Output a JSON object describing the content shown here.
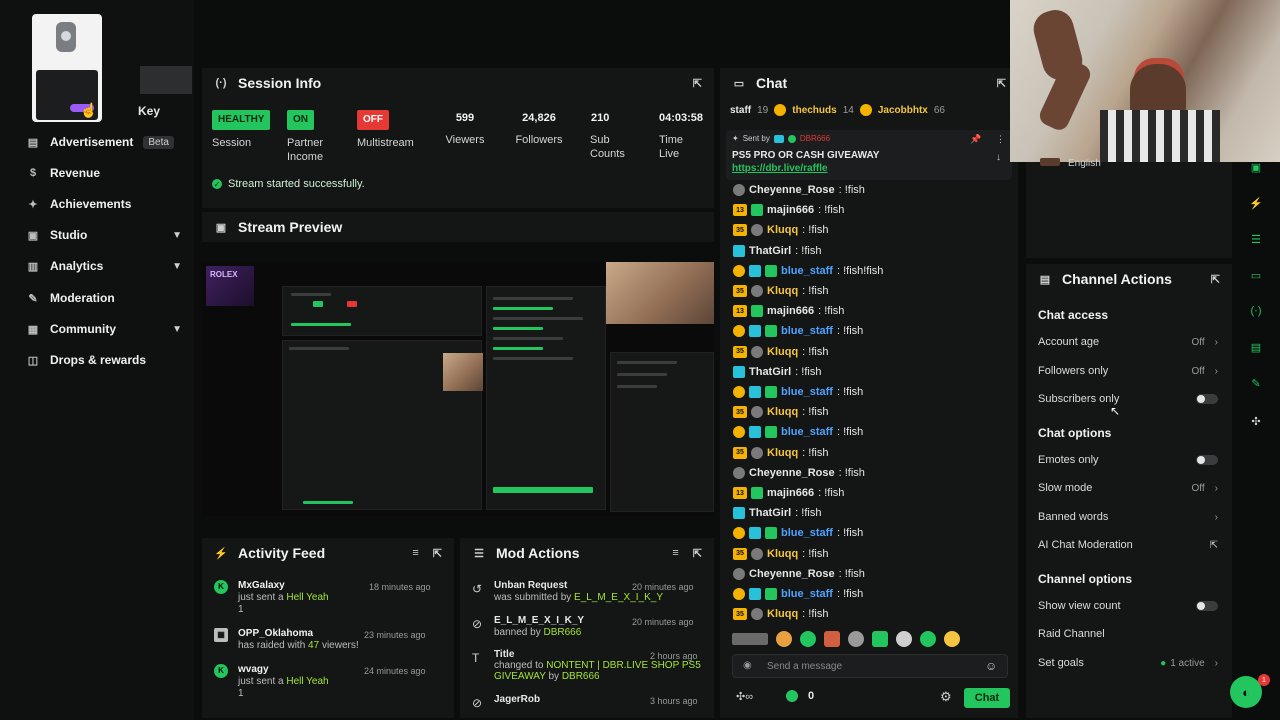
{
  "sidebar": {
    "key_label": "Key",
    "items": [
      {
        "label": "Advertisement",
        "badge": "Beta",
        "icon": "megaphone-icon"
      },
      {
        "label": "Revenue",
        "icon": "dollar-icon"
      },
      {
        "label": "Achievements",
        "icon": "trophy-icon"
      },
      {
        "label": "Studio",
        "icon": "camera-icon"
      },
      {
        "label": "Analytics",
        "icon": "chart-icon"
      },
      {
        "label": "Moderation",
        "icon": "wrench-icon"
      },
      {
        "label": "Community",
        "icon": "people-icon"
      },
      {
        "label": "Drops & rewards",
        "icon": "gift-icon"
      }
    ]
  },
  "session": {
    "title": "Session Info",
    "health": {
      "pill": "HEALTHY",
      "label": "Session"
    },
    "partner": {
      "pill": "ON",
      "label1": "Partner",
      "label2": "Income"
    },
    "multistream": {
      "pill": "OFF",
      "label": "Multistream"
    },
    "viewers": {
      "value": "599",
      "label": "Viewers"
    },
    "followers": {
      "value": "24,826",
      "label": "Followers"
    },
    "subs": {
      "value": "210",
      "label1": "Sub",
      "label2": "Counts"
    },
    "time": {
      "value": "04:03:58",
      "label1": "Time",
      "label2": "Live"
    },
    "success": "Stream started successfully."
  },
  "preview": {
    "title": "Stream Preview",
    "overlay_text": "ROLEX"
  },
  "activity": {
    "title": "Activity Feed",
    "items": [
      {
        "name": "MxGalaxy",
        "line1": "just sent a ",
        "highlight": "Hell Yeah",
        "line2": "1",
        "time": "18 minutes ago"
      },
      {
        "name": "OPP_Oklahoma",
        "line1": "has raided with ",
        "highlight": "47",
        "line1b": " viewers!",
        "time": "23 minutes ago"
      },
      {
        "name": "wvagy",
        "line1": "just sent a ",
        "highlight": "Hell Yeah",
        "line2": "1",
        "time": "24 minutes ago"
      }
    ]
  },
  "mod": {
    "title": "Mod Actions",
    "items": [
      {
        "name": "Unban Request",
        "line1": "was submitted by ",
        "highlight": "E_L_M_E_X_I_K_Y",
        "time": "20 minutes ago"
      },
      {
        "name": "E_L_M_E_X_I_K_Y",
        "line1": "banned by ",
        "highlight": "DBR666",
        "time": "20 minutes ago"
      },
      {
        "name": "Title",
        "line1": "changed to ",
        "highlight": "NONTENT | DBR.LIVE SHOP PS5 GIVEAWAY",
        "line1b": " by ",
        "highlight2": "DBR666",
        "time": "2 hours ago"
      },
      {
        "name": "JagerRob",
        "line1": "",
        "time": "3 hours ago"
      }
    ]
  },
  "chat": {
    "title": "Chat",
    "top_users": [
      {
        "label": "staff",
        "count": "19"
      },
      {
        "label": "thechuds",
        "count": "14"
      },
      {
        "label": "Jacobbhtx",
        "count": "66"
      }
    ],
    "pinned": {
      "sent_by": "Sent by",
      "user": "DBR666",
      "text": "PS5 PRO OR CASH GIVEAWAY",
      "link": "https://dbr.live/raffle"
    },
    "messages": [
      {
        "user": "Cheyenne_Rose",
        "color": "#e6e6e6",
        "text": "!fish",
        "badges": [
          "vip"
        ]
      },
      {
        "user": "majin666",
        "color": "#e6e6e6",
        "text": "!fish",
        "badges": [
          "n13",
          "gift"
        ]
      },
      {
        "user": "Kluqq",
        "color": "#f5c542",
        "text": "!fish",
        "badges": [
          "n35",
          "vip"
        ]
      },
      {
        "user": "ThatGirl",
        "color": "#e6e6e6",
        "text": "!fish",
        "badges": [
          "mod"
        ]
      },
      {
        "user": "blue_staff",
        "color": "#4fa3ff",
        "text": "!fish!fish",
        "badges": [
          "sub",
          "mod",
          "gift"
        ]
      },
      {
        "user": "Kluqq",
        "color": "#f5c542",
        "text": "!fish",
        "badges": [
          "n35",
          "vip"
        ]
      },
      {
        "user": "majin666",
        "color": "#e6e6e6",
        "text": "!fish",
        "badges": [
          "n13",
          "gift"
        ]
      },
      {
        "user": "blue_staff",
        "color": "#4fa3ff",
        "text": "!fish",
        "badges": [
          "sub",
          "mod",
          "gift"
        ]
      },
      {
        "user": "Kluqq",
        "color": "#f5c542",
        "text": "!fish",
        "badges": [
          "n35",
          "vip"
        ]
      },
      {
        "user": "ThatGirl",
        "color": "#e6e6e6",
        "text": "!fish",
        "badges": [
          "mod"
        ]
      },
      {
        "user": "blue_staff",
        "color": "#4fa3ff",
        "text": "!fish",
        "badges": [
          "sub",
          "mod",
          "gift"
        ]
      },
      {
        "user": "Kluqq",
        "color": "#f5c542",
        "text": "!fish",
        "badges": [
          "n35",
          "vip"
        ]
      },
      {
        "user": "blue_staff",
        "color": "#4fa3ff",
        "text": "!fish",
        "badges": [
          "sub",
          "mod",
          "gift"
        ]
      },
      {
        "user": "Kluqq",
        "color": "#f5c542",
        "text": "!fish",
        "badges": [
          "n35",
          "vip"
        ]
      },
      {
        "user": "Cheyenne_Rose",
        "color": "#e6e6e6",
        "text": "!fish",
        "badges": [
          "vip"
        ]
      },
      {
        "user": "majin666",
        "color": "#e6e6e6",
        "text": "!fish",
        "badges": [
          "n13",
          "gift"
        ]
      },
      {
        "user": "ThatGirl",
        "color": "#e6e6e6",
        "text": "!fish",
        "badges": [
          "mod"
        ]
      },
      {
        "user": "blue_staff",
        "color": "#4fa3ff",
        "text": "!fish",
        "badges": [
          "sub",
          "mod",
          "gift"
        ]
      },
      {
        "user": "Kluqq",
        "color": "#f5c542",
        "text": "!fish",
        "badges": [
          "n35",
          "vip"
        ]
      },
      {
        "user": "Cheyenne_Rose",
        "color": "#e6e6e6",
        "text": "!fish",
        "badges": [
          "vip"
        ]
      },
      {
        "user": "blue_staff",
        "color": "#4fa3ff",
        "text": "!fish",
        "badges": [
          "sub",
          "mod",
          "gift"
        ]
      },
      {
        "user": "Kluqq",
        "color": "#f5c542",
        "text": "!fish",
        "badges": [
          "n35",
          "vip"
        ]
      }
    ],
    "placeholder": "Send a message",
    "send_label": "Chat",
    "points": "0"
  },
  "language": "English",
  "channel_actions": {
    "title": "Channel Actions",
    "chat_access": "Chat access",
    "account_age": {
      "label": "Account age",
      "value": "Off"
    },
    "followers_only": {
      "label": "Followers only",
      "value": "Off"
    },
    "subscribers_only": {
      "label": "Subscribers only"
    },
    "chat_options": "Chat options",
    "emotes_only": {
      "label": "Emotes only"
    },
    "slow_mode": {
      "label": "Slow mode",
      "value": "Off"
    },
    "banned_words": {
      "label": "Banned words"
    },
    "ai_mod": {
      "label": "AI Chat Moderation"
    },
    "channel_options": "Channel options",
    "view_count": {
      "label": "Show view count"
    },
    "raid": {
      "label": "Raid Channel"
    },
    "goals": {
      "label": "Set goals",
      "value": "1 active"
    }
  },
  "colors": {
    "accent": "#22c55e",
    "danger": "#e53935",
    "panel": "#141515"
  }
}
